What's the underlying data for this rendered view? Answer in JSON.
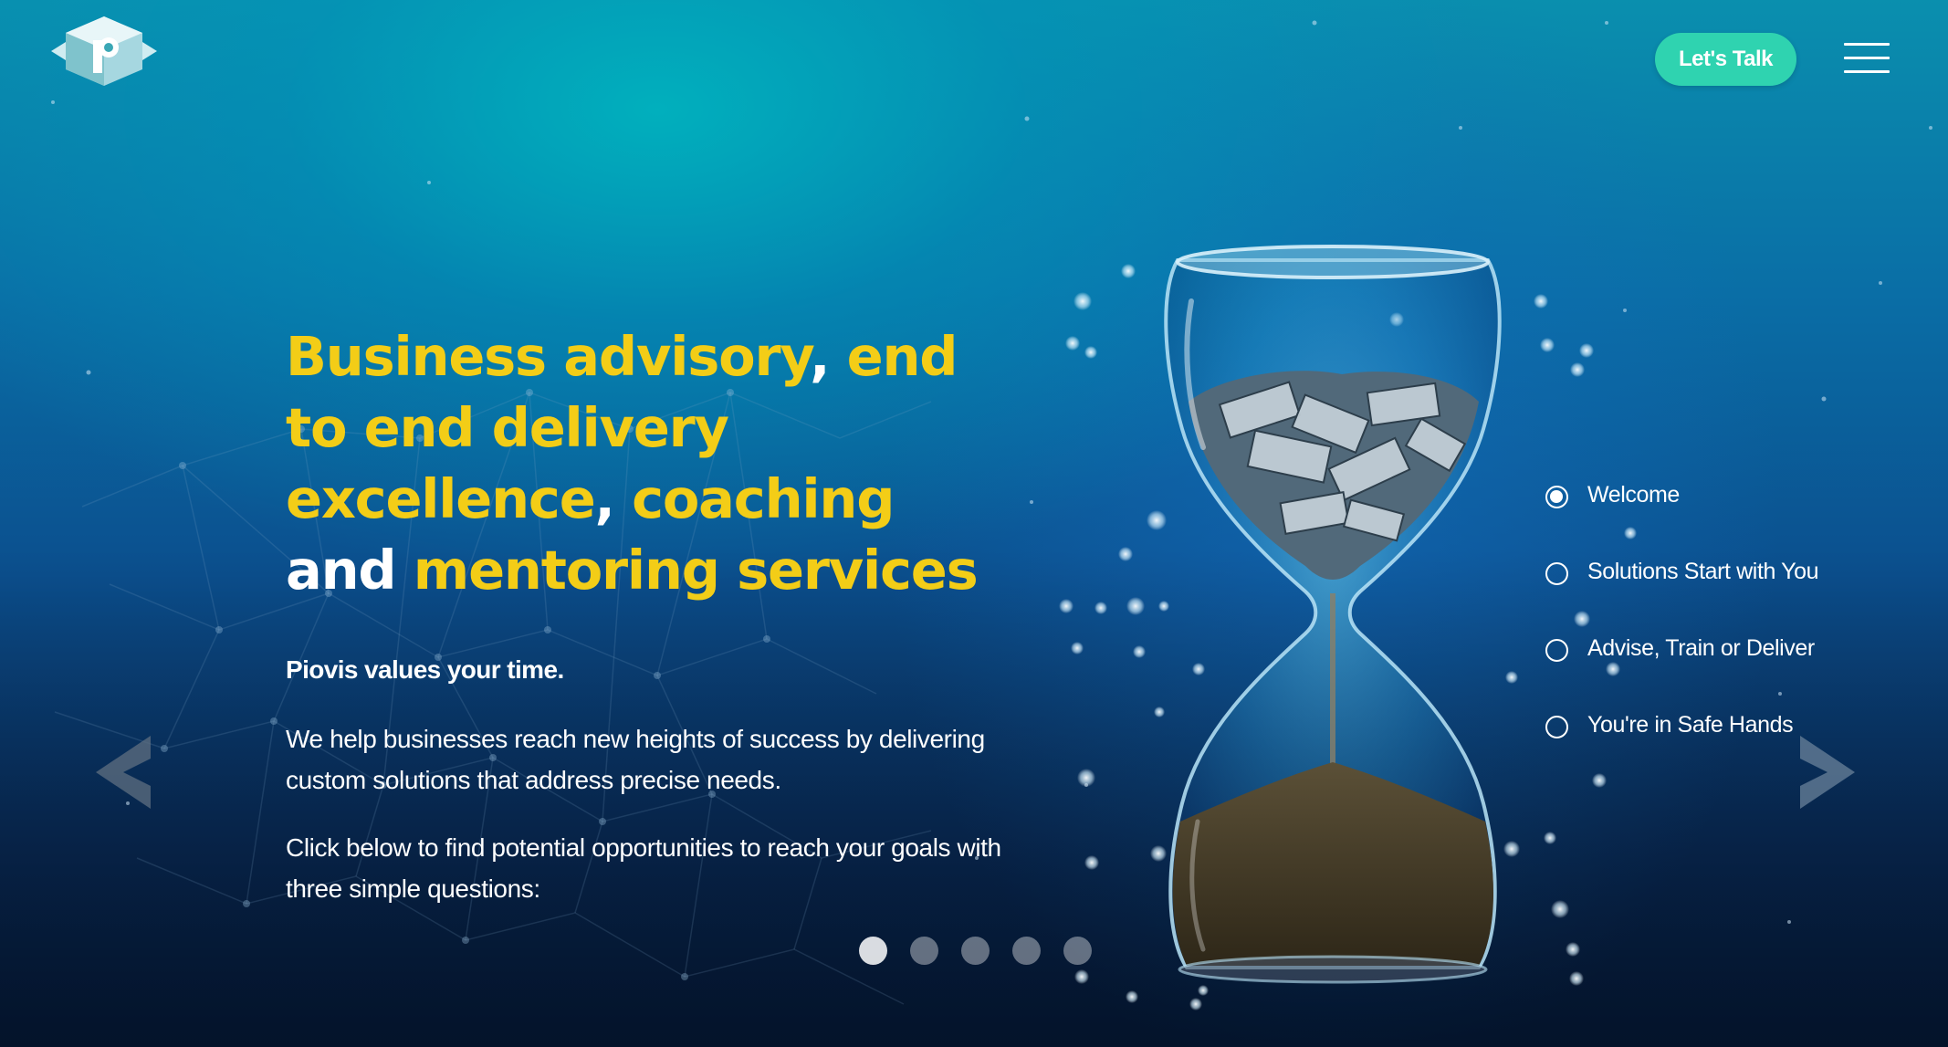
{
  "header": {
    "logo_icon": "piovis-p-logo-icon",
    "cta_label": "Let's Talk",
    "menu_icon": "hamburger-menu-icon"
  },
  "hero": {
    "headline": {
      "part1": "Business advisory",
      "comma1": ",",
      "part2": " end to end delivery excellence",
      "comma2": ",",
      "part3": " coaching",
      "and": " and",
      "part4": " mentoring services"
    },
    "subheading": "Piovis values your time.",
    "paragraph1": "We help businesses reach new heights of success by delivering custom solutions that address precise needs.",
    "paragraph2": "Click below to find potential opportunities to reach your goals with three simple questions:"
  },
  "carousel": {
    "prev_icon": "chevron-left-icon",
    "next_icon": "chevron-right-icon",
    "slide_count": 5,
    "active_slide": 1
  },
  "side_nav": {
    "items": [
      {
        "label": "Welcome",
        "active": true
      },
      {
        "label": "Solutions Start with You",
        "active": false
      },
      {
        "label": "Advise, Train or Deliver",
        "active": false
      },
      {
        "label": "You're in Safe Hands",
        "active": false
      }
    ]
  },
  "illustration": {
    "icon": "hourglass-with-money-icon"
  },
  "colors": {
    "accent_yellow": "#f3cd17",
    "cta_green": "#2fd3b0",
    "background_teal": "#0a8fae",
    "background_navy": "#081f45"
  }
}
